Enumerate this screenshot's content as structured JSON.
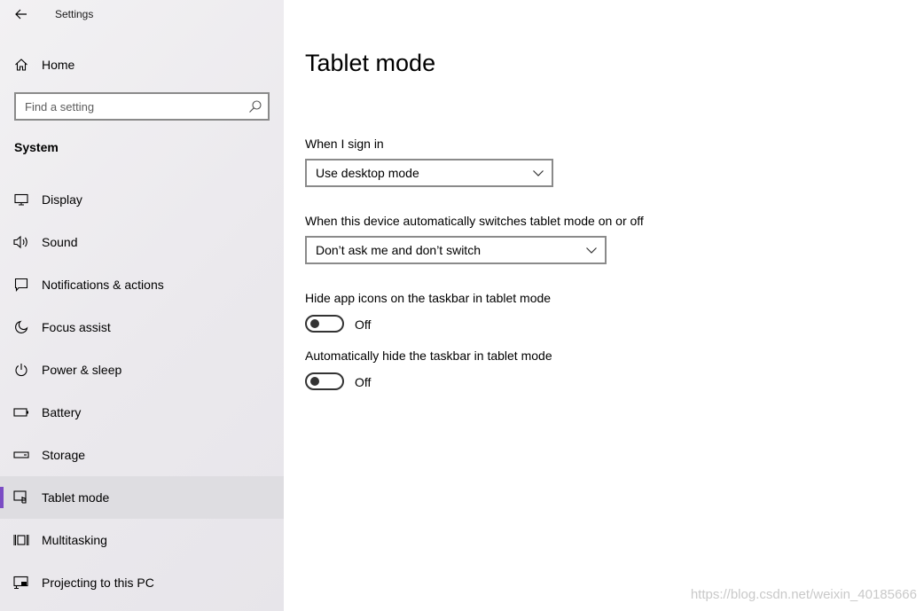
{
  "window": {
    "title": "Settings"
  },
  "sidebar": {
    "home_label": "Home",
    "search": {
      "placeholder": "Find a setting",
      "value": ""
    },
    "section_header": "System",
    "items": [
      {
        "label": "Display",
        "icon": "display-icon"
      },
      {
        "label": "Sound",
        "icon": "speaker-icon"
      },
      {
        "label": "Notifications & actions",
        "icon": "notification-icon"
      },
      {
        "label": "Focus assist",
        "icon": "moon-icon"
      },
      {
        "label": "Power & sleep",
        "icon": "power-icon"
      },
      {
        "label": "Battery",
        "icon": "battery-icon"
      },
      {
        "label": "Storage",
        "icon": "storage-icon"
      },
      {
        "label": "Tablet mode",
        "icon": "tablet-mode-icon",
        "selected": true
      },
      {
        "label": "Multitasking",
        "icon": "multitasking-icon"
      },
      {
        "label": "Projecting to this PC",
        "icon": "projecting-icon"
      }
    ],
    "accent_color": "#7b4cc4"
  },
  "main": {
    "title": "Tablet mode",
    "sign_in": {
      "label": "When I sign in",
      "selected": "Use desktop mode"
    },
    "auto_switch": {
      "label": "When this device automatically switches tablet mode on or off",
      "selected": "Don’t ask me and don’t switch"
    },
    "hide_icons": {
      "label": "Hide app icons on the taskbar in tablet mode",
      "state": "Off"
    },
    "hide_taskbar": {
      "label": "Automatically hide the taskbar in tablet mode",
      "state": "Off"
    }
  },
  "watermark": "https://blog.csdn.net/weixin_40185666"
}
